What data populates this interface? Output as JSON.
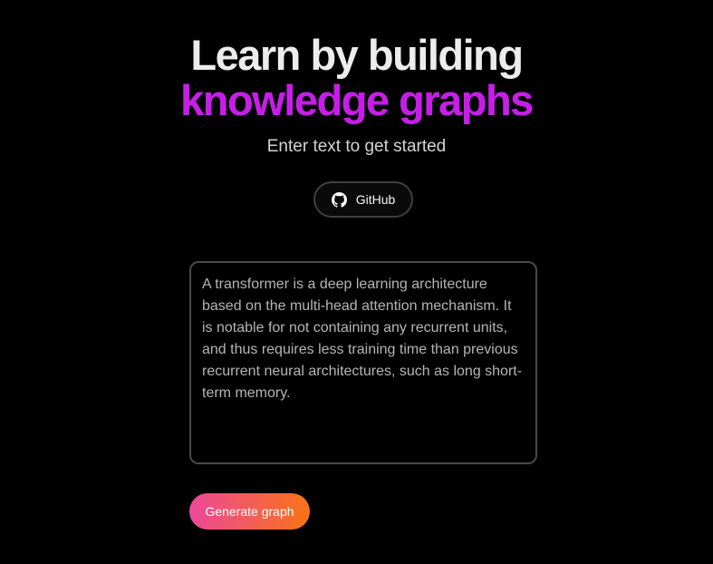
{
  "hero": {
    "title_line1": "Learn by building",
    "title_line2": "knowledge graphs",
    "subtitle": "Enter text to get started"
  },
  "github": {
    "label": "GitHub",
    "icon": "github-icon"
  },
  "input": {
    "value": "A transformer is a deep learning architecture based on the multi-head attention mechanism. It is notable for not containing any recurrent units, and thus requires less training time than previous recurrent neural architectures, such as long short-term memory."
  },
  "actions": {
    "generate_label": "Generate graph"
  },
  "colors": {
    "background": "#000000",
    "accent_title": "#c61ee8",
    "button_gradient_start": "#ec4899",
    "button_gradient_end": "#f97316"
  }
}
